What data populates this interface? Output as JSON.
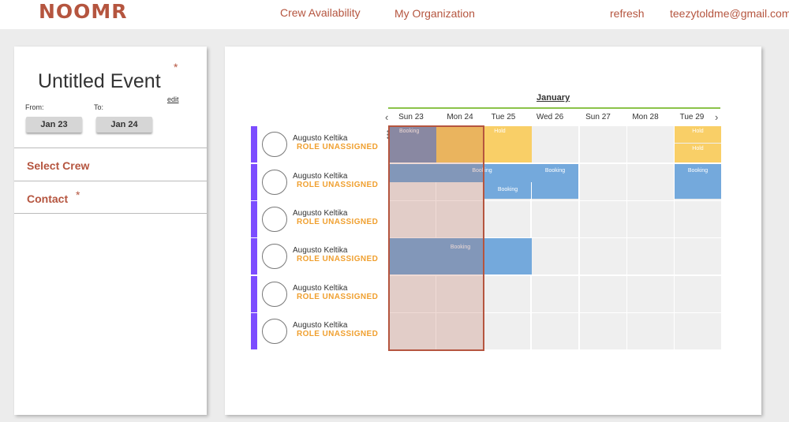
{
  "header": {
    "logo": "NOOMR",
    "nav": [
      "Crew Availability",
      "My Organization"
    ],
    "refresh": "refresh",
    "user_email": "teezytoldme@gmail.com"
  },
  "event": {
    "title": "Untitled Event",
    "edit": "edit",
    "from_label": "From:",
    "to_label": "To:",
    "from_date": "Jan 23",
    "to_date": "Jan 24",
    "sections": [
      "Select Crew",
      "Contact"
    ]
  },
  "calendar": {
    "month": "January",
    "days": [
      "Sun 23",
      "Mon 24",
      "Tue 25",
      "Wed 26",
      "Sun 27",
      "Mon 28",
      "Tue 29"
    ],
    "crew": [
      {
        "name": "Augusto Keltika",
        "role": "ROLE UNASSIGNED"
      },
      {
        "name": "Augusto Keltika",
        "role": "ROLE UNASSIGNED"
      },
      {
        "name": "Augusto Keltika",
        "role": "ROLE UNASSIGNED"
      },
      {
        "name": "Augusto Keltika",
        "role": "ROLE UNASSIGNED"
      },
      {
        "name": "Augusto Keltika",
        "role": "ROLE UNASSIGNED"
      },
      {
        "name": "Augusto Keltika",
        "role": "ROLE UNASSIGNED"
      }
    ],
    "block_labels": {
      "booking": "Booking",
      "hold": "Hold"
    }
  },
  "colors": {
    "brand": "#b5553f",
    "booking": "#74a9dc",
    "hold": "#f9cf67",
    "role": "#f0a030",
    "accent": "#7c4dff"
  }
}
